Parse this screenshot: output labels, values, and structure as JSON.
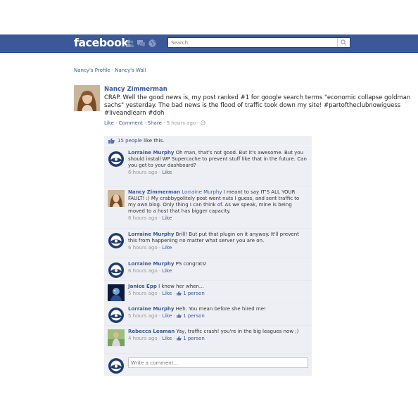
{
  "header": {
    "logo": "facebook",
    "search_placeholder": "Search",
    "brand_color": "#3b5998"
  },
  "breadcrumb": {
    "profile": "Nancy's Profile",
    "separator": "·",
    "wall": "Nancy's Wall"
  },
  "post": {
    "author": "Nancy Zimmerman",
    "text": "CRAP. Well the good news is, my post ranked #1 for google search terms \"economic collapse goldman sachs\" yesterday. The bad news is the flood of traffic took down my site! #partoftheclubnowiguess #liveandlearn #doh",
    "actions": {
      "like": "Like",
      "comment": "Comment",
      "share": "Share",
      "time": "9 hours ago",
      "sep": "·"
    }
  },
  "likes": {
    "text": "15 people",
    "suffix": " like this."
  },
  "comments": [
    {
      "author": "Lorraine Murphy",
      "mention": "",
      "text": " Oh man, that's not good. But it's awesome. But you should install WP Supercache to prevent stuff like that in the future. Can you get to your dashboard?",
      "time": "6 hours ago",
      "like": "Like",
      "likes_count": "",
      "avatar": "murphy-logo"
    },
    {
      "author": "Nancy Zimmerman",
      "mention": " Lorraine Murphy",
      "text": " I meant to say IT'S ALL YOUR FAULT! :) My crabbygolitely post went nuts I guess, and sent traffic to my own blog. Only thing I can think of. As we speak, mine is being moved to a host that has bigger capacity.",
      "time": "6 hours ago",
      "like": "Like",
      "likes_count": "",
      "avatar": "nancy-photo"
    },
    {
      "author": "Lorraine Murphy",
      "mention": "",
      "text": " Brill! But put that plugin on it anyway. It'll prevent this from happening no matter what server you are on.",
      "time": "6 hours ago",
      "like": "Like",
      "likes_count": "",
      "avatar": "murphy-logo"
    },
    {
      "author": "Lorraine Murphy",
      "mention": "",
      "text": " PS congrats!",
      "time": "6 hours ago",
      "like": "Like",
      "likes_count": "",
      "avatar": "murphy-logo"
    },
    {
      "author": "Janice Epp",
      "mention": "",
      "text": " I knew her when...",
      "time": "5 hours ago",
      "like": "Like",
      "likes_count": "1 person",
      "avatar": "janice-photo"
    },
    {
      "author": "Lorraine Murphy",
      "mention": "",
      "text": " Heh. You mean before she hired me!",
      "time": "5 hours ago",
      "like": "Like",
      "likes_count": "1 person",
      "avatar": "murphy-logo"
    },
    {
      "author": "Rebecca Leaman",
      "mention": "",
      "text": " Yay, traffic crash! you're in the big leagues now ;)",
      "time": "4 hours ago",
      "like": "Like",
      "likes_count": "1 person",
      "avatar": "rebecca-photo"
    }
  ],
  "write_comment": {
    "placeholder": "Write a comment..."
  }
}
